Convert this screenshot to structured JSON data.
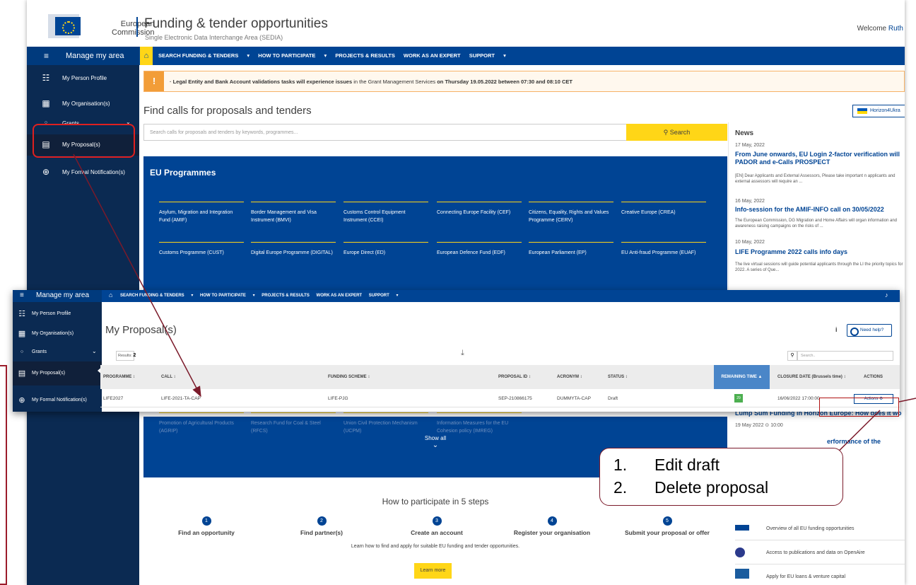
{
  "header": {
    "logo_text_1": "European",
    "logo_text_2": "Commission",
    "title": "Funding & tender opportunities",
    "subtitle": "Single Electronic Data Interchange Area (SEDIA)",
    "welcome_prefix": "Welcome",
    "welcome_user": "Ruth"
  },
  "topnav": {
    "menu_label": "Manage my area",
    "links": [
      "SEARCH FUNDING & TENDERS",
      "HOW TO PARTICIPATE",
      "PROJECTS & RESULTS",
      "WORK AS AN EXPERT",
      "SUPPORT"
    ]
  },
  "sidebar": {
    "items": [
      {
        "label": "My Person Profile",
        "icon": "person-profile-icon"
      },
      {
        "label": "My Organisation(s)",
        "icon": "building-icon"
      },
      {
        "label": "Grants",
        "icon": "circle-icon"
      },
      {
        "label": "My Proposal(s)",
        "icon": "proposal-icon"
      },
      {
        "label": "My Formal Notification(s)",
        "icon": "globe-icon"
      }
    ]
  },
  "alert": {
    "lead": "· Legal Entity and Bank Account validations tasks will experience issues",
    "middle": " in the Grant Management Services ",
    "tail": "on Thursday 19.05.2022 between 07:30 and 08:10 CET"
  },
  "find": {
    "title": "Find calls for proposals and tenders",
    "placeholder": "Search calls for proposals and tenders by keywords, programmes...",
    "button": "Search",
    "ukraine_button": "Horizon4Ukra"
  },
  "programmes": {
    "title": "EU Programmes",
    "row1": [
      "Asylum, Migration and Integration Fund (AMIF)",
      "Border Management and Visa Instrument (BMVI)",
      "Customs Control Equipment Instrument (CCEI)",
      "Connecting Europe Facility (CEF)",
      "Citizens, Equality, Rights and Values Programme (CERV)",
      "Creative Europe (CREA)"
    ],
    "row2": [
      "Customs Programme (CUST)",
      "Digital Europe Programme (DIGITAL)",
      "Europe Direct (ED)",
      "European Defence Fund (EDF)",
      "European Parliament (EP)",
      "EU Anti-fraud Programme (EUAF)"
    ],
    "row_low": [
      "Promotion of Agricultural Products (AGRIP)",
      "Research Fund for Coal & Steel (RFCS)",
      "Union Civil Protection Mechanism (UCPM)",
      "Information Measures for the EU Cohesion policy (IMREG)"
    ],
    "show_all": "Show all"
  },
  "news": {
    "title": "News",
    "items": [
      {
        "date": "17 May, 2022",
        "headline": "From June onwards, EU Login 2-factor verification will PADOR and e-Calls PROSPECT",
        "text": "[EN] Dear Applicants and External Assessors, Please take important n applicants and external assessors will require an ..."
      },
      {
        "date": "16 May, 2022",
        "headline": "Info-session for the AMIF-INFO call on 30/05/2022",
        "text": "The European Commission, DG Migration and Home Affairs will organ information and awareness raising campaigns on the risks of ..."
      },
      {
        "date": "10 May, 2022",
        "headline": "LIFE Programme 2022 calls info days",
        "text": "The live virtual sessions will guide potential applicants through the LI the priority topics for 2022. A series of Que..."
      }
    ]
  },
  "events": {
    "headline": "Lump Sum Funding in Horizon Europe: How does it wo",
    "meta": "19 May 2022   ⊙ 10:00",
    "headline2": "erformance of the"
  },
  "steps": {
    "title": "How to participate in 5 steps",
    "items": [
      {
        "num": "1",
        "label": "Find an opportunity"
      },
      {
        "num": "2",
        "label": "Find partner(s)"
      },
      {
        "num": "3",
        "label": "Create an account"
      },
      {
        "num": "4",
        "label": "Register your organisation"
      },
      {
        "num": "5",
        "label": "Submit your proposal or offer"
      }
    ],
    "text": "Learn how to find and apply for suitable EU funding and tender opportunities.",
    "button": "Learn more"
  },
  "links_panel": [
    {
      "label": "Overview of all EU funding opportunities"
    },
    {
      "label": "Access to publications and data on OpenAire"
    },
    {
      "label": "Apply for EU loans & venture capital"
    }
  ],
  "proposals": {
    "title": "My Proposal(s)",
    "need_help": "Need help?",
    "info_icon": "i",
    "results_label": "Results:",
    "results_count": "2",
    "search_placeholder": "Search..",
    "columns": [
      "PROGRAMME ↕",
      "CALL ↕",
      "FUNDING SCHEME ↕",
      "PROPOSAL ID ↕",
      "ACRONYM ↕",
      "STATUS ↕",
      "REMAINING TIME ▲",
      "CLOSURE DATE (Brussels time) ↕",
      "ACTIONS"
    ],
    "row": {
      "programme": "LIFE2027",
      "call": "LIFE-2021-TA-CAP",
      "funding_scheme": "LIFE-PJG",
      "proposal_id": "SEP-210866175",
      "acronym": "DUMMYTA-CAP",
      "status": "Draft",
      "remaining": "29",
      "closure_date": "16/06/2022 17:00:00",
      "actions": "Actions ⚙"
    }
  },
  "callout": {
    "lines": [
      {
        "num": "1.",
        "text": "Edit draft"
      },
      {
        "num": "2.",
        "text": "Delete proposal"
      }
    ]
  },
  "colors": {
    "ec_blue": "#004494",
    "yellow": "#ffd617",
    "sidebar_dark": "#0b2a52",
    "annotation_red": "#e0201f",
    "annotation_maroon": "#7b1a2a"
  }
}
